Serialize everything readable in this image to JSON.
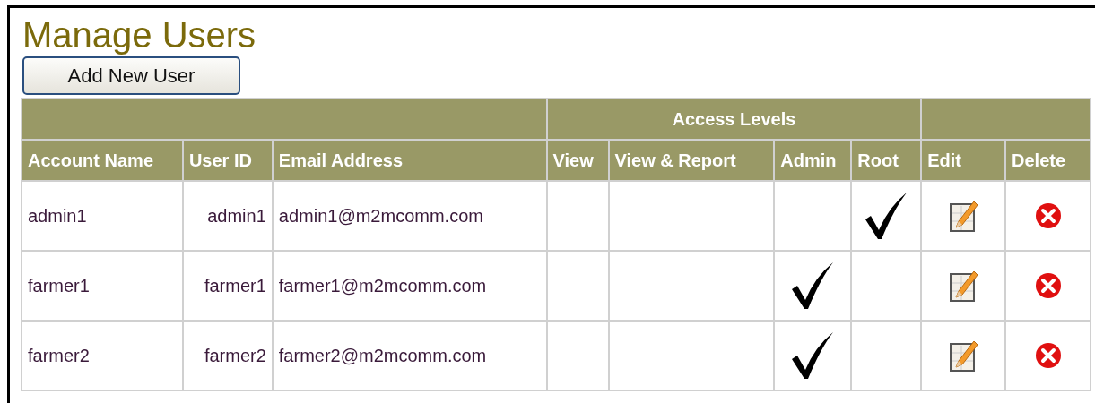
{
  "page_title": "Manage Users",
  "add_button": "Add New User",
  "table": {
    "group_header": "Access Levels",
    "columns": [
      "Account Name",
      "User ID",
      "Email Address",
      "View",
      "View & Report",
      "Admin",
      "Root",
      "Edit",
      "Delete"
    ],
    "rows": [
      {
        "account_name": "admin1",
        "user_id": "admin1",
        "email": "admin1@m2mcomm.com",
        "access": [
          {
            "checked": false
          },
          {
            "checked": false
          },
          {
            "checked": false
          },
          {
            "checked": true
          }
        ]
      },
      {
        "account_name": "farmer1",
        "user_id": "farmer1",
        "email": "farmer1@m2mcomm.com",
        "access": [
          {
            "checked": false
          },
          {
            "checked": false
          },
          {
            "checked": true
          },
          {
            "checked": false
          }
        ]
      },
      {
        "account_name": "farmer2",
        "user_id": "farmer2",
        "email": "farmer2@m2mcomm.com",
        "access": [
          {
            "checked": false
          },
          {
            "checked": false
          },
          {
            "checked": true
          },
          {
            "checked": false
          }
        ]
      }
    ]
  }
}
